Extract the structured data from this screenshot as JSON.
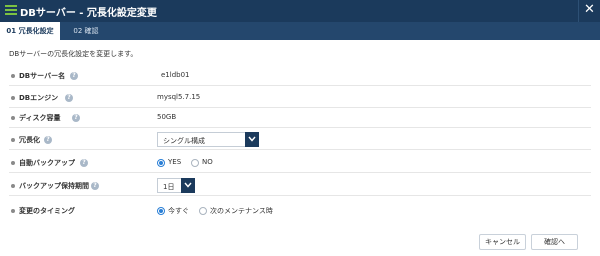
{
  "window": {
    "title": "DBサーバー - 冗長化設定変更",
    "close_icon": "close-icon"
  },
  "tabs": [
    {
      "label": "01 冗長化設定",
      "active": true
    },
    {
      "label": "02 確認",
      "active": false
    }
  ],
  "intro": "DBサーバーの冗長化設定を変更します。",
  "fields": {
    "db_server_name": {
      "label": "DBサーバー名",
      "value": "e1ldb01"
    },
    "db_engine": {
      "label": "DBエンジン",
      "value": "mysql5.7.15"
    },
    "disk_capacity": {
      "label": "ディスク容量",
      "value": "50GB"
    },
    "redundancy": {
      "label": "冗長化",
      "selected": "シングル構成"
    },
    "auto_backup": {
      "label": "自動バックアップ",
      "options": [
        "YES",
        "NO"
      ],
      "selected": "YES"
    },
    "backup_retention": {
      "label": "バックアップ保持期間",
      "selected": "1日"
    },
    "change_timing": {
      "label": "変更のタイミング",
      "options": [
        "今すぐ",
        "次のメンテナンス時"
      ],
      "selected": "今すぐ"
    }
  },
  "help_icon_glyph": "?",
  "footer": {
    "cancel_label": "キャンセル",
    "confirm_label": "確認へ"
  },
  "colors": {
    "header": "#1b3a5c",
    "tab_bar": "#24476d",
    "accent": "#2a7fd6",
    "logo": "#7cc242"
  }
}
